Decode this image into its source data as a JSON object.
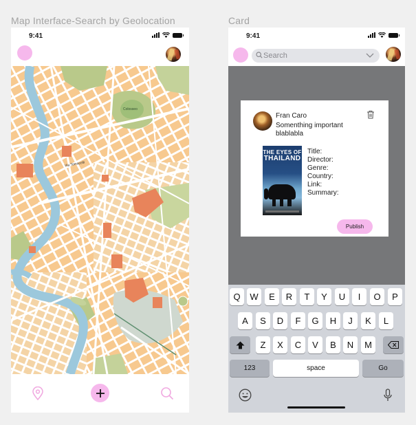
{
  "frames": {
    "left_title": "Map Interface-Search by Geolocation",
    "right_title": "Card"
  },
  "status": {
    "time": "9:41"
  },
  "search": {
    "placeholder": "Search"
  },
  "map": {
    "labels": [
      "Via Tomacelli",
      "Colosseo"
    ]
  },
  "tabbar": {
    "items": [
      "location-pin-icon",
      "plus-icon",
      "search-icon"
    ]
  },
  "card": {
    "author": "Fran Caro",
    "text": "Somenthing important blablabla",
    "poster": {
      "line1": "THE EYES OF",
      "line2": "THAILAND"
    },
    "fields": [
      "Title:",
      "Director:",
      "Genre:",
      "Country:",
      "Link:",
      "Summary:"
    ],
    "publish_label": "Publish"
  },
  "keyboard": {
    "row1": [
      "Q",
      "W",
      "E",
      "R",
      "T",
      "Y",
      "U",
      "I",
      "O",
      "P"
    ],
    "row2": [
      "A",
      "S",
      "D",
      "F",
      "G",
      "H",
      "J",
      "K",
      "L"
    ],
    "row3": [
      "Z",
      "X",
      "C",
      "V",
      "B",
      "N",
      "M"
    ],
    "numbers_label": "123",
    "space_label": "space",
    "go_label": "Go"
  },
  "colors": {
    "accent_pink": "#f6b8ec",
    "overlay_gray": "#767779",
    "keyboard_bg": "#d1d4da"
  }
}
